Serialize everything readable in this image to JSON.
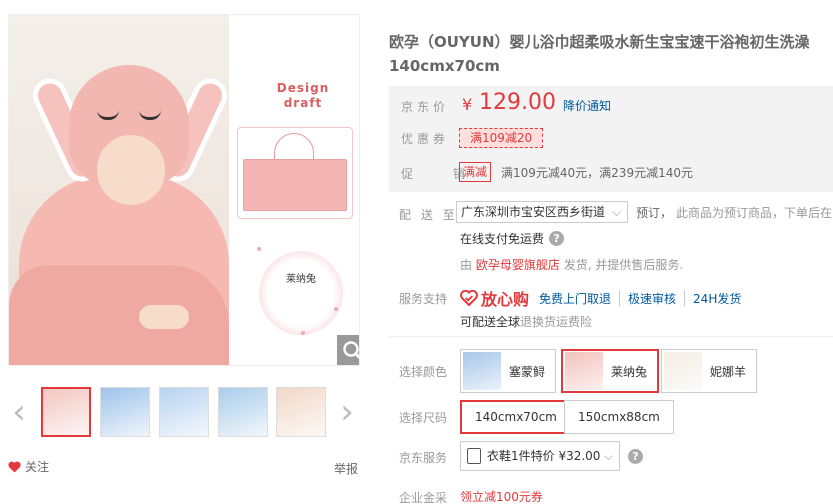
{
  "gallery": {
    "design_line1": "Design",
    "design_line2": "draft",
    "variant_name": "莱纳兔",
    "prev_arrow": "‹",
    "next_arrow": "›",
    "follow_label": "关注",
    "report_label": "举报",
    "thumb_colors": [
      "#f3c6c1",
      "#9fc3ea",
      "#b7d3f0",
      "#a9cdea",
      "#f0d8c8"
    ]
  },
  "product": {
    "title_line1": "欧孕（OUYUN）婴儿浴巾超柔吸水新生宝宝速干浴袍初生洗澡",
    "title_line2": "140cmx70cm"
  },
  "price": {
    "label": "京东价",
    "currency": "¥",
    "value": "129.00",
    "notify": "降价通知",
    "coupon_label": "优惠券",
    "coupon": "满109减20",
    "promo_label": "促 销",
    "promo_tag": "满减",
    "promo_text": "满109元减40元，满239元减140元"
  },
  "delivery": {
    "label": "配 送 至",
    "address": "广东深圳市宝安区西乡街道",
    "presale": "预订，",
    "presale_note": "此商品为预订商品，下单后在",
    "free_shipping": "在线支付免运费",
    "ship_prefix": "由",
    "shop": "欧孕母婴旗舰店",
    "ship_suffix": "发货, 并提供售后服务."
  },
  "service": {
    "label": "服务支持",
    "badge": "放心购",
    "items": [
      "免费上门取退",
      "极速审核",
      "24H发货"
    ],
    "note_main": "可配送全球",
    "note_gray": "退换货运费险"
  },
  "options": {
    "color_label": "选择颜色",
    "colors": [
      {
        "name": "塞蒙鲟",
        "swatch": "#a7c7ea"
      },
      {
        "name": "莱纳兔",
        "swatch": "#f3c2bd"
      },
      {
        "name": "妮娜羊",
        "swatch": "#f3ede4"
      }
    ],
    "size_label": "选择尺码",
    "sizes": [
      "140cmx70cm",
      "150cmx88cm"
    ],
    "jd_service_label": "京东服务",
    "jd_service": "衣鞋1件特价 ¥32.00",
    "biz_label": "企业金采",
    "biz_coupon": "领立减100元券"
  },
  "colors": {
    "accent": "#e4393c",
    "link": "#005aa0"
  }
}
